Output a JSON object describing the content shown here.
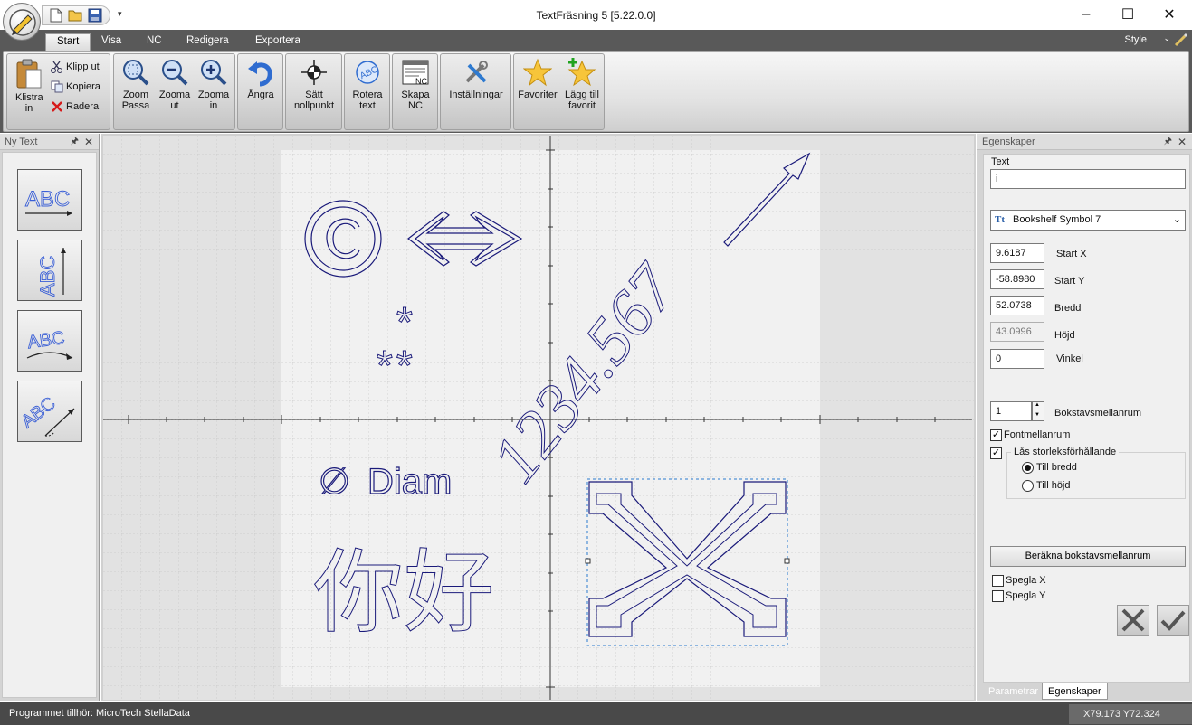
{
  "window": {
    "title": "TextFräsning 5  [5.22.0.0]",
    "minimize": "–",
    "maximize": "☐",
    "close": "✕"
  },
  "qat": {
    "more": "▾"
  },
  "tabs": [
    {
      "label": "Start",
      "active": true
    },
    {
      "label": "Visa"
    },
    {
      "label": "NC"
    },
    {
      "label": "Redigera"
    },
    {
      "label": "Exportera"
    }
  ],
  "style_menu": {
    "label": "Style",
    "arrow": "⌄"
  },
  "ribbon": {
    "paste": "Klistra in",
    "cut": "Klipp ut",
    "copy": "Kopiera",
    "delete": "Radera",
    "zoom_fit": "Zoom Passa",
    "zoom_out": "Zooma ut",
    "zoom_in": "Zooma in",
    "undo": "Ångra",
    "set_origin": "Sätt nollpunkt",
    "rotate_text": "Rotera text",
    "create_nc": "Skapa NC",
    "settings": "Inställningar",
    "favorites": "Favoriter",
    "add_favorite": "Lägg till favorit",
    "nc_icon_text": "NC",
    "rotate_icon_text": "ABC"
  },
  "left_panel": {
    "title": "Ny Text",
    "pin": "🖈",
    "close": "✕",
    "tool_text": "ABC"
  },
  "canvas": {
    "texts": {
      "asterisk_top": "*",
      "asterisks_bottom": "**",
      "diam": "Diam",
      "diam_symbol": "∅",
      "diagonal": "1234.567",
      "chinese": "你好"
    },
    "colors": {
      "outline": "#1a1a7a",
      "axis": "#333333",
      "grid": "#c8c8c8",
      "selection": "#2a7bd0"
    }
  },
  "right_panel": {
    "title": "Egenskaper",
    "pin": "🖈",
    "close": "✕",
    "text_label": "Text",
    "text_value": "i",
    "font_name": "Bookshelf Symbol 7",
    "font_icon": "Tt",
    "dropdown_arrow": "⌄",
    "start_x": {
      "value": "9.6187",
      "label": "Start X"
    },
    "start_y": {
      "value": "-58.8980",
      "label": "Start Y"
    },
    "width": {
      "value": "52.0738",
      "label": "Bredd"
    },
    "height": {
      "value": "43.0996",
      "label": "Höjd"
    },
    "angle": {
      "value": "0",
      "label": "Vinkel"
    },
    "letter_spacing": {
      "value": "1",
      "label": "Bokstavsmellanrum"
    },
    "spin_up": "▲",
    "spin_down": "▼",
    "font_spacing": {
      "label": "Fontmellanrum",
      "checked": true
    },
    "lock_ratio": {
      "label": "Lås storleksförhållande",
      "checked": true
    },
    "check_mark": "✓",
    "to_width": {
      "label": "Till bredd",
      "selected": true
    },
    "to_height": {
      "label": "Till höjd",
      "selected": false
    },
    "calc_button": "Beräkna bokstavsmellanrum",
    "mirror_x": {
      "label": "Spegla X",
      "checked": false
    },
    "mirror_y": {
      "label": "Spegla Y",
      "checked": false
    },
    "tabs": [
      {
        "label": "Parametrar"
      },
      {
        "label": "Egenskaper",
        "active": true
      }
    ]
  },
  "status": {
    "text": "Programmet tillhör: MicroTech StellaData",
    "coords": "X79.173  Y72.324"
  }
}
